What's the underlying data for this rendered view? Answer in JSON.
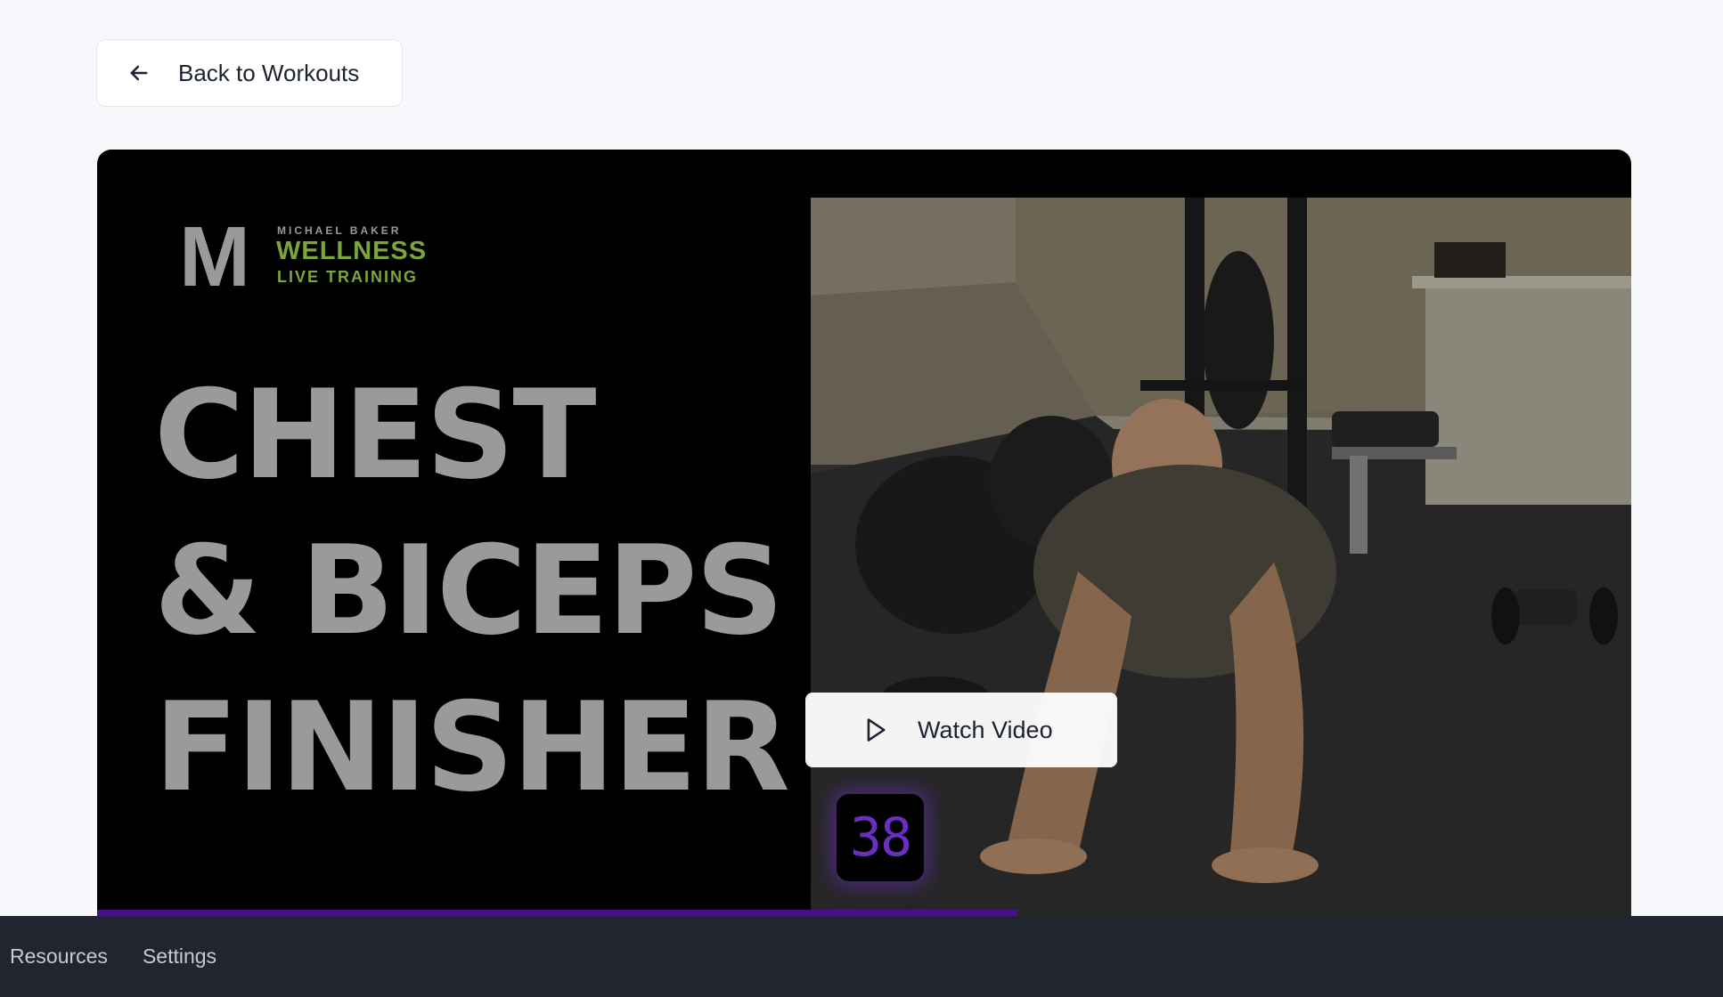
{
  "back_button": {
    "label": "Back to Workouts",
    "icon": "arrow-left-icon"
  },
  "video": {
    "logo": {
      "letter": "M",
      "small_text": "MICHAEL BAKER",
      "brand": "WELLNESS",
      "subtitle": "LIVE TRAINING",
      "brand_color": "#7ca63c"
    },
    "title_lines": [
      "CHEST",
      "& BICEPS",
      "FINISHER"
    ],
    "timer": "38",
    "timer_color": "#6a2fc0",
    "progress": 0.6,
    "progress_color": "#4b0e8a",
    "watch_button": {
      "label": "Watch Video",
      "icon": "play-icon"
    }
  },
  "bottom_nav": {
    "items": [
      {
        "label": "Resources"
      },
      {
        "label": "Settings"
      }
    ]
  }
}
